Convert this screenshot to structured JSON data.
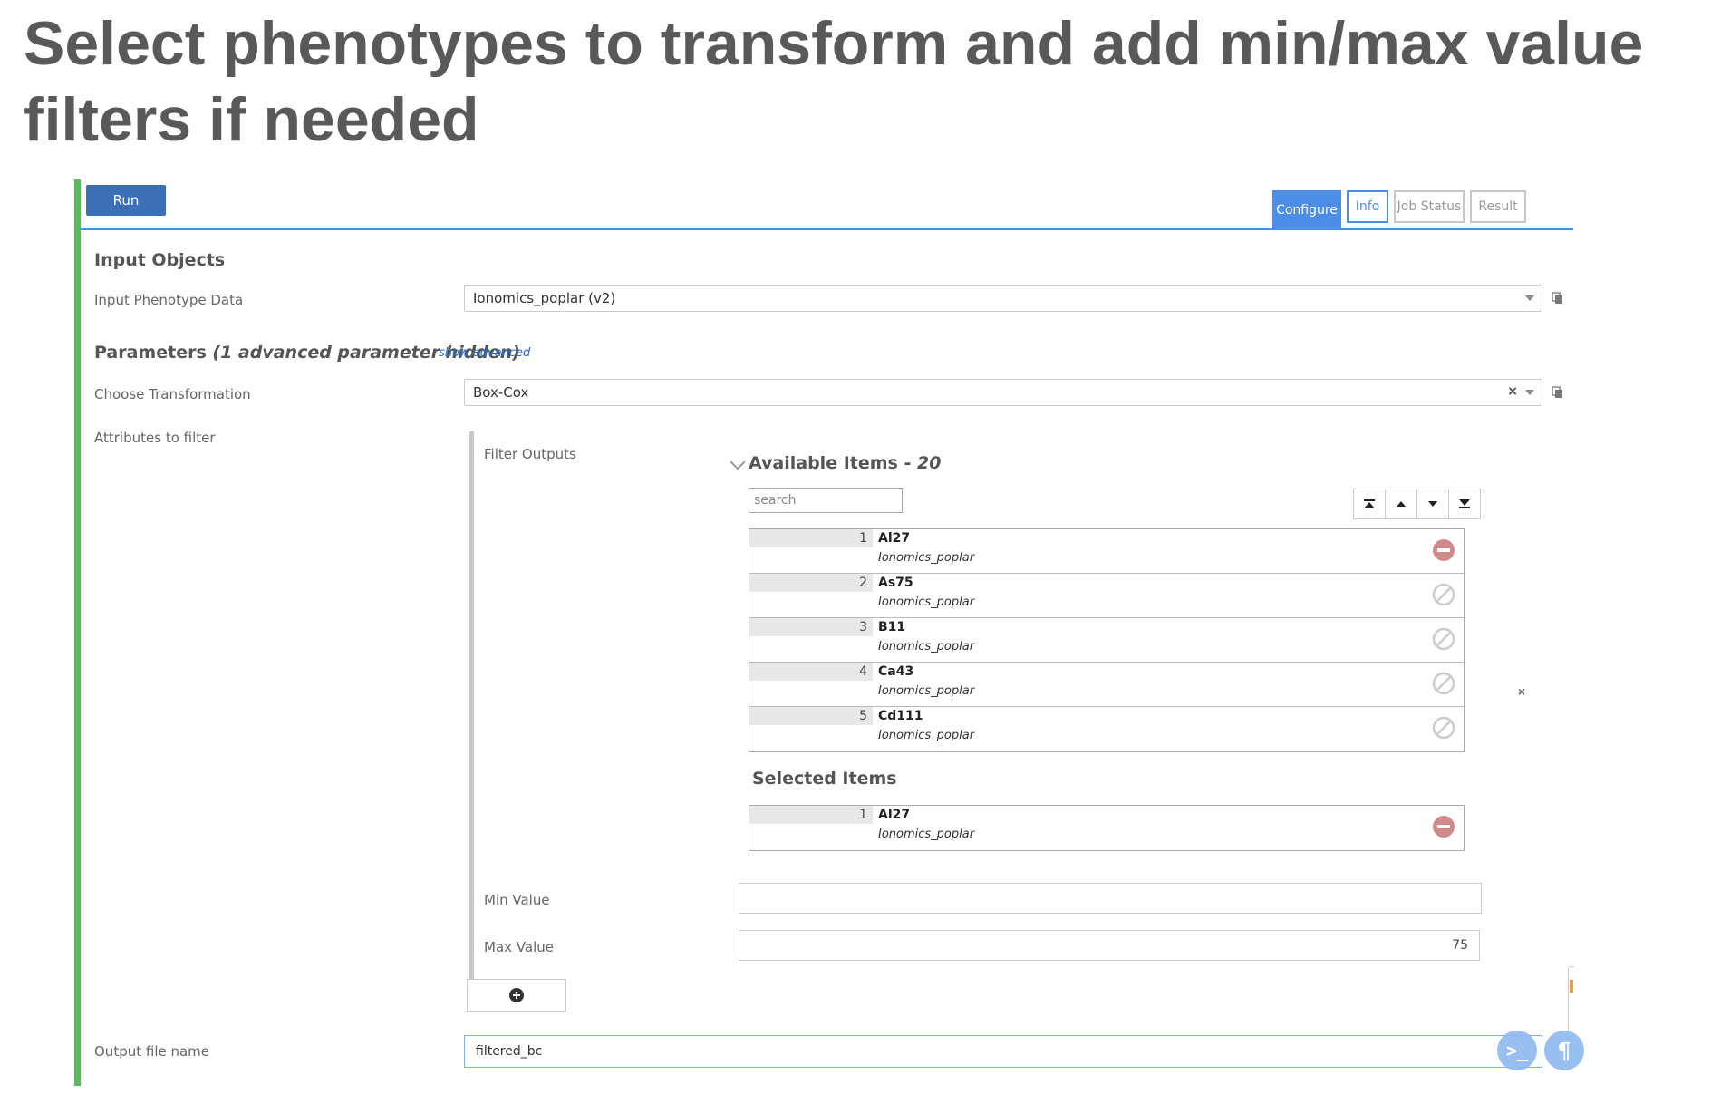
{
  "slide": {
    "title": "Select phenotypes to transform and add min/max value filters if needed"
  },
  "toolbar": {
    "run_label": "Run"
  },
  "tabs": [
    {
      "label": "Configure",
      "active": true
    },
    {
      "label": "Info",
      "active": false
    },
    {
      "label": "Job Status",
      "active": false
    },
    {
      "label": "Result",
      "active": false
    }
  ],
  "input_objects": {
    "heading": "Input Objects",
    "phenotype_label": "Input Phenotype Data",
    "phenotype_value": "Ionomics_poplar (v2)"
  },
  "parameters": {
    "heading": "Parameters",
    "hidden_note": "(1 advanced parameter hidden)",
    "show_advanced": "show advanced",
    "transformation_label": "Choose Transformation",
    "transformation_value": "Box-Cox",
    "attributes_label": "Attributes to filter",
    "filter_outputs_label": "Filter Outputs"
  },
  "available": {
    "heading_prefix": "Available Items - ",
    "count": "20",
    "search_placeholder": "search",
    "items": [
      {
        "num": "1",
        "name": "Al27",
        "source": "Ionomics_poplar",
        "state": "remove"
      },
      {
        "num": "2",
        "name": "As75",
        "source": "Ionomics_poplar",
        "state": "available"
      },
      {
        "num": "3",
        "name": "B11",
        "source": "Ionomics_poplar",
        "state": "available"
      },
      {
        "num": "4",
        "name": "Ca43",
        "source": "Ionomics_poplar",
        "state": "available"
      },
      {
        "num": "5",
        "name": "Cd111",
        "source": "Ionomics_poplar",
        "state": "available"
      }
    ]
  },
  "selected": {
    "heading": "Selected Items",
    "items": [
      {
        "num": "1",
        "name": "Al27",
        "source": "Ionomics_poplar"
      }
    ]
  },
  "filters": {
    "min_label": "Min Value",
    "min_value": "",
    "max_label": "Max Value",
    "max_value": "75"
  },
  "output": {
    "label": "Output file name",
    "value": "filtered_bc"
  },
  "colors": {
    "accent": "#4c8ee6",
    "run_button": "#3b6fb6",
    "panel_bar": "#5cb85c",
    "remove_icon": "#d08a8a"
  },
  "icons": [
    "copy-icon",
    "clear-icon",
    "chevron-down-icon",
    "move-top-icon",
    "move-up-icon",
    "move-down-icon",
    "move-bottom-icon",
    "remove-icon",
    "disabled-icon",
    "close-icon",
    "plus-circle-icon",
    "terminal-icon",
    "pilcrow-icon"
  ]
}
